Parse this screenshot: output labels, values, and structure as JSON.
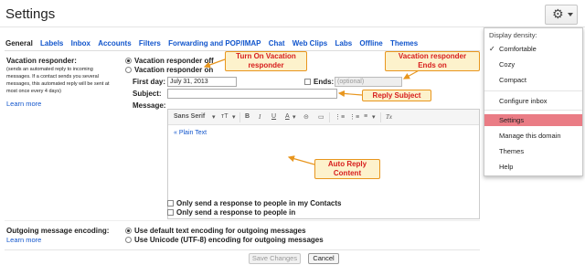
{
  "header": {
    "title": "Settings"
  },
  "tabs": [
    "General",
    "Labels",
    "Inbox",
    "Accounts",
    "Filters",
    "Forwarding and POP/IMAP",
    "Chat",
    "Web Clips",
    "Labs",
    "Offline",
    "Themes"
  ],
  "vacation": {
    "label": "Vacation responder:",
    "description": "(sends an automated reply to incoming messages. If a contact sends you several messages, this automated reply will be sent at most once every 4 days)",
    "learn_more": "Learn more",
    "option_off": "Vacation responder off",
    "option_on": "Vacation responder on",
    "selected": "off",
    "first_day_label": "First day:",
    "first_day_value": "July 31, 2013",
    "ends_label": "Ends:",
    "ends_placeholder": "(optional)",
    "subject_label": "Subject:",
    "subject_value": "",
    "message_label": "Message:",
    "plain_text_link": "« Plain Text",
    "contacts_only": "Only send a response to people in my Contacts",
    "domain_only": "Only send a response to people in"
  },
  "toolbar": {
    "font": "Sans Serif",
    "size": "тT",
    "bold": "B",
    "italic": "I",
    "underline": "U",
    "text_color": "A",
    "link": "⊝",
    "image": "▭",
    "numbered": "⋮≡",
    "bulleted": "⋮≡",
    "align": "≡",
    "remove_format": "Tx"
  },
  "encoding": {
    "label": "Outgoing message encoding:",
    "learn_more": "Learn more",
    "option_default": "Use default text encoding for outgoing messages",
    "option_unicode": "Use Unicode (UTF-8) encoding for outgoing messages",
    "selected": "default"
  },
  "buttons": {
    "save": "Save Changes",
    "cancel": "Cancel"
  },
  "menu": {
    "density_label": "Display density:",
    "items": [
      "Comfortable",
      "Cozy",
      "Compact"
    ],
    "selected_density": "Comfortable",
    "configure_inbox": "Configure inbox",
    "settings": "Settings",
    "manage_domain": "Manage this domain",
    "themes": "Themes",
    "help": "Help"
  },
  "callouts": {
    "turn_on": "Turn On Vacation responder",
    "ends_on": "Vacation responder Ends on",
    "reply_subject": "Reply Subject",
    "auto_reply": "Auto Reply Content"
  },
  "colors": {
    "link": "#1155cc",
    "callout_text": "#d71d1d",
    "callout_border": "#e8961e",
    "callout_bg": "#fdf2cc",
    "menu_highlight": "#ea7c85"
  }
}
